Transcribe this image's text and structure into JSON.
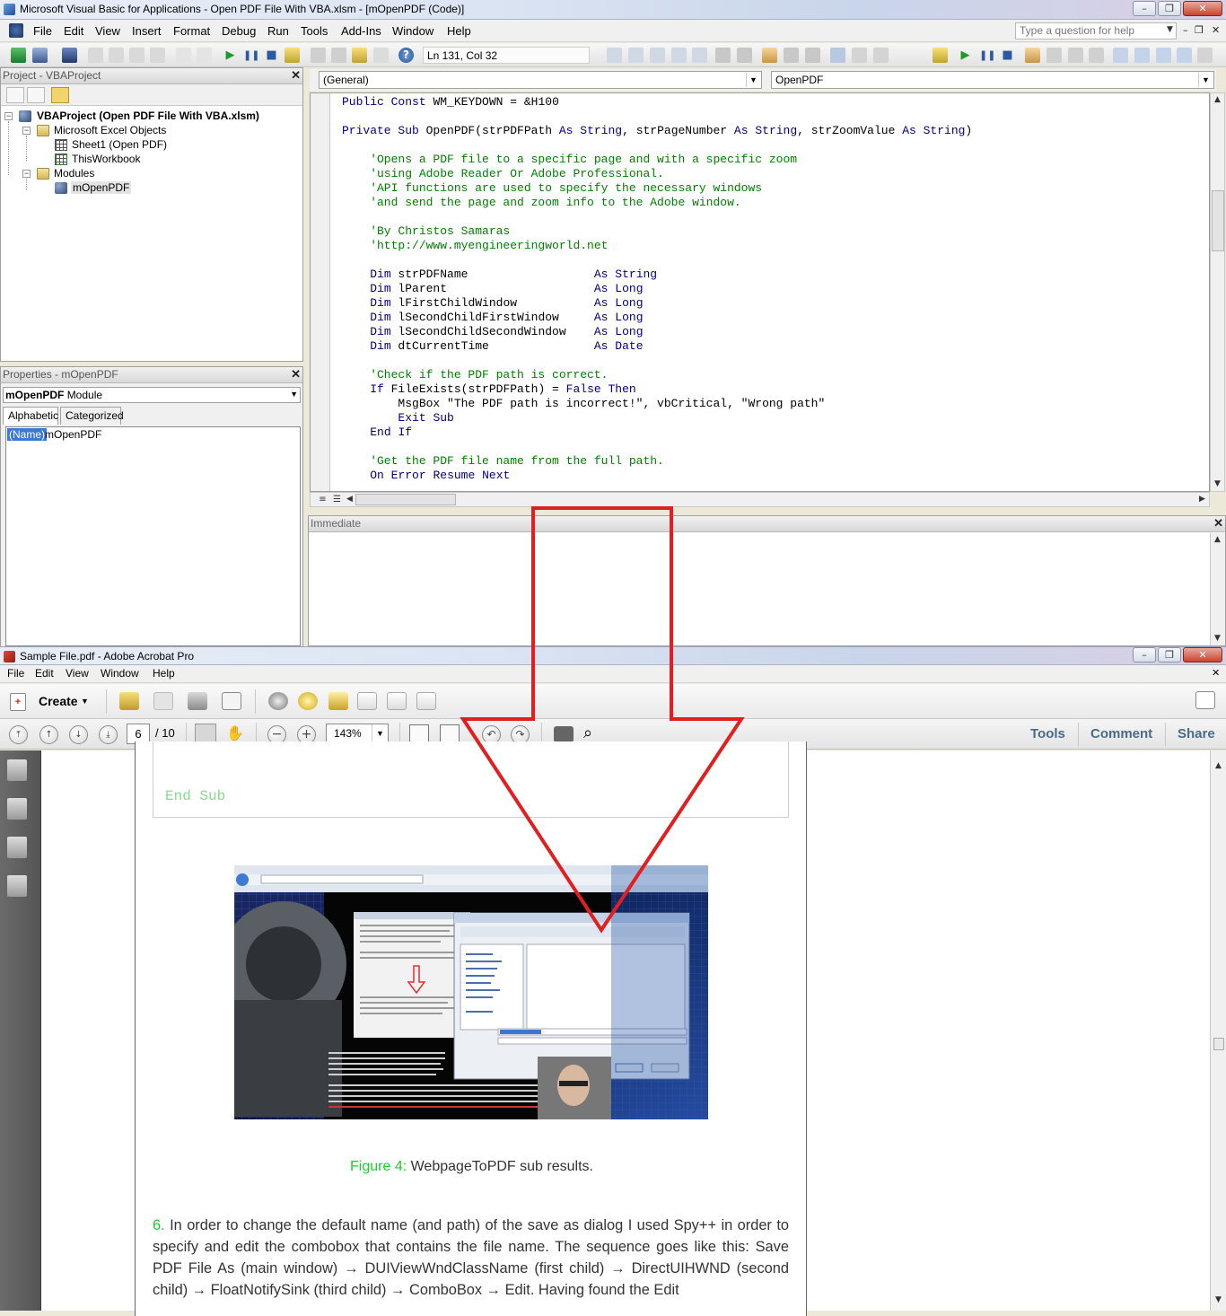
{
  "vba": {
    "title": "Microsoft Visual Basic for Applications - Open PDF File With VBA.xlsm - [mOpenPDF (Code)]",
    "menu": [
      "File",
      "Edit",
      "View",
      "Insert",
      "Format",
      "Debug",
      "Run",
      "Tools",
      "Add-Ins",
      "Window",
      "Help"
    ],
    "help_placeholder": "Type a question for help",
    "status_position": "Ln 131, Col 32",
    "project": {
      "header": "Project - VBAProject",
      "tree": {
        "root": "VBAProject (Open PDF File With VBA.xlsm)",
        "excel_objects": "Microsoft Excel Objects",
        "sheet1": "Sheet1 (Open PDF)",
        "this_workbook": "ThisWorkbook",
        "modules": "Modules",
        "module": "mOpenPDF"
      }
    },
    "properties": {
      "header": "Properties - mOpenPDF",
      "combo_bold": "mOpenPDF",
      "combo_rest": "Module",
      "tabs": [
        "Alphabetic",
        "Categorized"
      ],
      "row_name": "(Name)",
      "row_value": "mOpenPDF"
    },
    "code": {
      "object_combo": "(General)",
      "procedure_combo": "OpenPDF",
      "lines": [
        "Public Const WM_KEYDOWN = &H100",
        "",
        "Private Sub OpenPDF(strPDFPath As String, strPageNumber As String, strZoomValue As String)",
        "",
        "    'Opens a PDF file to a specific page and with a specific zoom",
        "    'using Adobe Reader Or Adobe Professional.",
        "    'API functions are used to specify the necessary windows",
        "    'and send the page and zoom info to the Adobe window.",
        "",
        "    'By Christos Samaras",
        "    'http://www.myengineeringworld.net",
        "",
        "    Dim strPDFName                  As String",
        "    Dim lParent                     As Long",
        "    Dim lFirstChildWindow           As Long",
        "    Dim lSecondChildFirstWindow     As Long",
        "    Dim lSecondChildSecondWindow    As Long",
        "    Dim dtCurrentTime               As Date",
        "",
        "    'Check if the PDF path is correct.",
        "    If FileExists(strPDFPath) = False Then",
        "        MsgBox \"The PDF path is incorrect!\", vbCritical, \"Wrong path\"",
        "        Exit Sub",
        "    End If",
        "",
        "    'Get the PDF file name from the full path.",
        "    On Error Resume Next"
      ]
    },
    "immediate": {
      "header": "Immediate"
    }
  },
  "acrobat": {
    "title": "Sample File.pdf - Adobe Acrobat Pro",
    "menu": [
      "File",
      "Edit",
      "View",
      "Window",
      "Help"
    ],
    "create_label": "Create",
    "page_current": "6",
    "page_total": "/ 10",
    "zoom": "143%",
    "right_tabs": [
      "Tools",
      "Comment",
      "Share"
    ],
    "doc": {
      "code_tail": "End Sub",
      "figure_number": "Figure 4:",
      "figure_caption": " WebpageToPDF sub results.",
      "para_number": "6.",
      "paragraph": " In order to change the default name (and path) of the save as dialog I used Spy++ in order to specify and edit the combobox that contains the file name. The sequence goes like this: Save PDF File As (main window) → DUIViewWndClassName (first child) → DirectUIHWND (second child) → FloatNotifySink (third child) → ComboBox → Edit. Having found the Edit"
    }
  },
  "colors": {
    "keyword": "#00007f",
    "comment": "#008000",
    "arrow": "#e02020",
    "figure_label": "#1bcf2a",
    "pdf_code": "#8bd98b"
  }
}
